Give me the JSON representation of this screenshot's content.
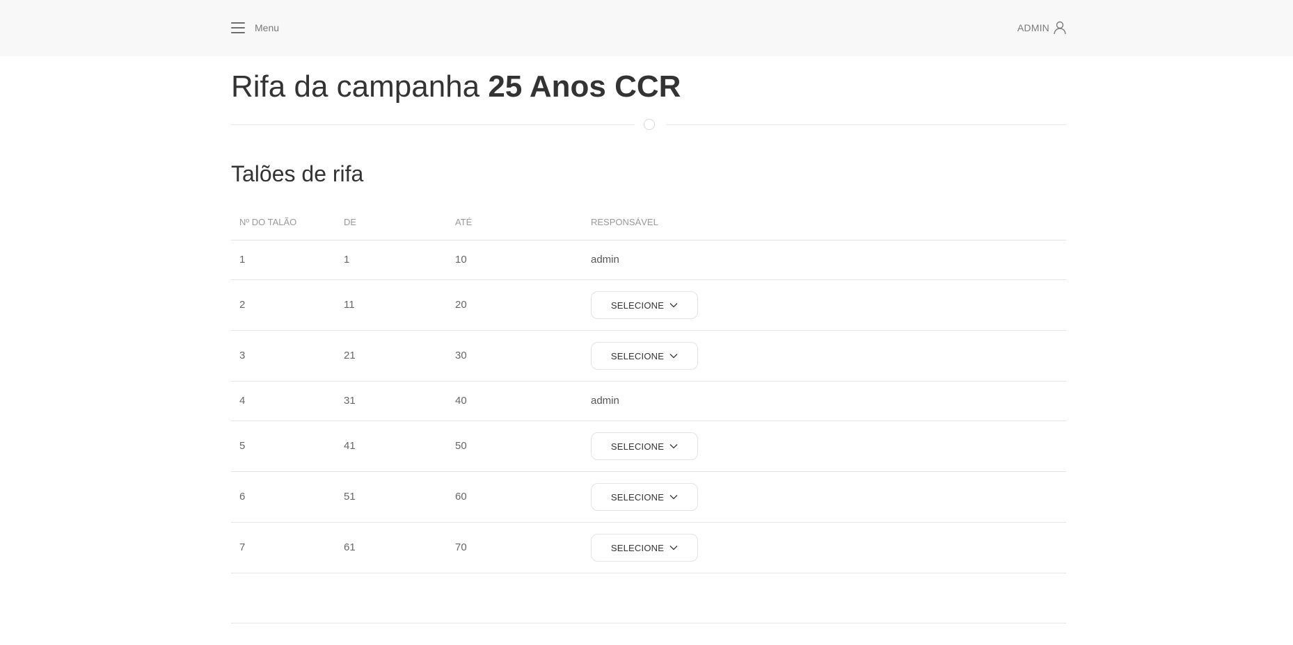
{
  "header": {
    "menu_label": "Menu",
    "user_label": "ADMIN"
  },
  "page": {
    "title_prefix": "Rifa da campanha ",
    "title_bold": "25 Anos CCR",
    "subtitle": "Talões de rifa"
  },
  "table": {
    "columns": [
      "Nº DO TALÃO",
      "DE",
      "ATÉ",
      "RESPONSÁVEL"
    ],
    "select_label": "SELECIONE",
    "rows": [
      {
        "numero": "1",
        "de": "1",
        "ate": "10",
        "responsavel": "admin"
      },
      {
        "numero": "2",
        "de": "11",
        "ate": "20",
        "responsavel": ""
      },
      {
        "numero": "3",
        "de": "21",
        "ate": "30",
        "responsavel": ""
      },
      {
        "numero": "4",
        "de": "31",
        "ate": "40",
        "responsavel": "admin"
      },
      {
        "numero": "5",
        "de": "41",
        "ate": "50",
        "responsavel": ""
      },
      {
        "numero": "6",
        "de": "51",
        "ate": "60",
        "responsavel": ""
      },
      {
        "numero": "7",
        "de": "61",
        "ate": "70",
        "responsavel": ""
      }
    ]
  },
  "icons": {
    "menu": "hamburger-menu-icon",
    "user": "user-icon",
    "dropdown": "chevron-down-icon"
  }
}
